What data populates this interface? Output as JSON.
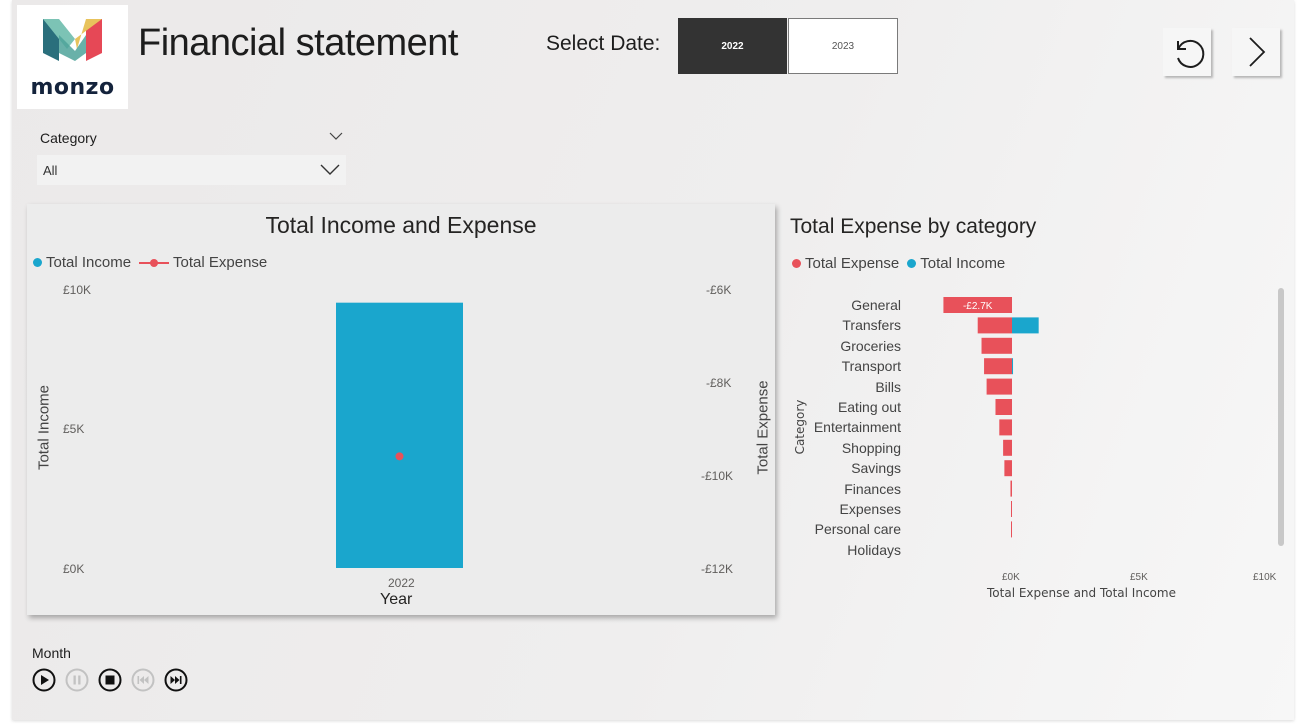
{
  "app": {
    "logo_text": "monzo",
    "page_title": "Financial statement"
  },
  "date_selector": {
    "label": "Select Date:",
    "options": [
      "2022",
      "2023"
    ],
    "selected": "2022"
  },
  "nav": {
    "reset_icon": "undo-icon",
    "next_icon": "chevron-right-icon"
  },
  "category_slicer": {
    "label": "Category",
    "value": "All"
  },
  "colors": {
    "income": "#1aa6cd",
    "expense": "#e8515a",
    "button_active": "#333333"
  },
  "income_expense_chart": {
    "title": "Total Income and Expense",
    "legend": [
      "Total Income",
      "Total Expense"
    ],
    "left_ticks": [
      "£10K",
      "£5K",
      "£0K"
    ],
    "right_ticks": [
      "-£6K",
      "-£8K",
      "-£10K",
      "-£12K"
    ],
    "y_left_label": "Total Income",
    "y_right_label": "Total Expense",
    "x_label": "Year",
    "x_tick": "2022"
  },
  "category_chart": {
    "title": "Total Expense by category",
    "legend": [
      "Total Expense",
      "Total Income"
    ],
    "y_label": "Category",
    "x_label": "Total Expense and Total Income",
    "x_ticks": [
      "£0K",
      "£5K",
      "£10K"
    ],
    "data_label": "-£2.7K",
    "categories": [
      "General",
      "Transfers",
      "Groceries",
      "Transport",
      "Bills",
      "Eating out",
      "Entertainment",
      "Shopping",
      "Savings",
      "Finances",
      "Expenses",
      "Personal care",
      "Holidays"
    ]
  },
  "chart_data": [
    {
      "type": "bar",
      "title": "Total Income and Expense",
      "categories": [
        "2022"
      ],
      "series": [
        {
          "name": "Total Income",
          "values": [
            9900
          ],
          "axis": "left"
        },
        {
          "name": "Total Expense",
          "values": [
            -9500
          ],
          "axis": "right"
        }
      ],
      "xlabel": "Year",
      "ylabel": "Total Income",
      "y2label": "Total Expense",
      "ylim": [
        0,
        10000
      ],
      "y2lim": [
        -12000,
        -6000
      ]
    },
    {
      "type": "bar",
      "orientation": "horizontal",
      "title": "Total Expense by category",
      "categories": [
        "General",
        "Transfers",
        "Groceries",
        "Transport",
        "Bills",
        "Eating out",
        "Entertainment",
        "Shopping",
        "Savings",
        "Finances",
        "Expenses",
        "Personal care",
        "Holidays"
      ],
      "series": [
        {
          "name": "Total Expense",
          "values": [
            -2700,
            -1350,
            -1200,
            -1100,
            -1000,
            -650,
            -500,
            -350,
            -300,
            -60,
            -40,
            -20,
            0
          ]
        },
        {
          "name": "Total Income",
          "values": [
            0,
            1050,
            0,
            40,
            0,
            0,
            0,
            0,
            0,
            0,
            0,
            0,
            0
          ]
        }
      ],
      "xlabel": "Total Expense and Total Income",
      "ylabel": "Category",
      "xlim": [
        -3000,
        10000
      ]
    }
  ],
  "playback": {
    "label": "Month",
    "controls": [
      "play-icon",
      "pause-icon",
      "stop-icon",
      "previous-icon",
      "next-icon"
    ]
  }
}
